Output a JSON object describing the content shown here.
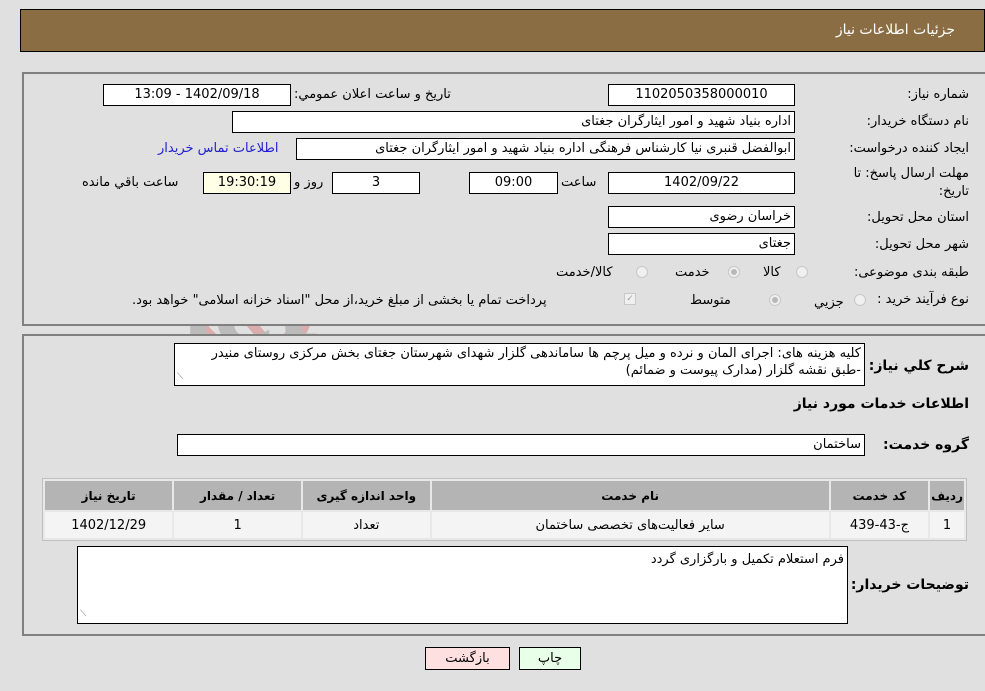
{
  "header": {
    "title": "جزئیات اطلاعات نیاز"
  },
  "details": {
    "need_number": {
      "label": "شماره نیاز:",
      "value": "1102050358000010"
    },
    "announce_datetime": {
      "label": "تاریخ و ساعت اعلان عمومي:",
      "value": "1402/09/18 - 13:09"
    },
    "buyer_org": {
      "label": "نام دستگاه خريدار:",
      "value": "اداره بنیاد شهید و امور ایثارگران جغتای"
    },
    "requester": {
      "label": "ايجاد کننده درخواست:",
      "value": "ابوالفضل قنبری نیا کارشناس فرهنگی اداره بنیاد شهید و امور ایثارگران جغتای",
      "contact_link": "اطلاعات تماس خريدار"
    },
    "deadline": {
      "label_line1": "مهلت ارسال پاسخ: تا",
      "label_line2": "تاریخ:",
      "date": "1402/09/22",
      "time_label": "ساعت",
      "time": "09:00",
      "days": "3",
      "days_label": "روز و",
      "remaining": "19:30:19",
      "remaining_label": "ساعت باقي مانده"
    },
    "province": {
      "label": "استان محل تحويل:",
      "value": "خراسان رضوی"
    },
    "city": {
      "label": "شهر محل تحويل:",
      "value": "جغتای"
    },
    "category": {
      "label": "طبقه بندی موضوعی:",
      "options": [
        {
          "label": "کالا",
          "checked": false
        },
        {
          "label": "خدمت",
          "checked": true
        },
        {
          "label": "کالا/خدمت",
          "checked": false
        }
      ]
    },
    "purchase_type": {
      "label": "نوع فرآیند خرید :",
      "options": [
        {
          "label": "جزيي",
          "checked": false
        },
        {
          "label": "متوسط",
          "checked": true
        }
      ],
      "payment_note": "پرداخت تمام یا بخشی از مبلغ خرید،از محل \"اسناد خزانه اسلامی\" خواهد بود.",
      "payment_checked": true
    }
  },
  "description": {
    "label": "شرح کلي نياز:",
    "value": "کلیه هزینه های: اجرای المان و نرده و میل پرچم ها ساماندهی گلزار شهدای شهرستان جغتای بخش مرکزی روستای منیدر -طبق نقشه گلزار (مدارک پیوست و ضمائم)"
  },
  "services": {
    "section_title": "اطلاعات خدمات مورد نياز",
    "group_label": "گروه خدمت:",
    "group_value": "ساختمان",
    "table": {
      "headers": [
        "رديف",
        "کد خدمت",
        "نام خدمت",
        "واحد اندازه گیری",
        "تعداد / مقدار",
        "تاریخ نیاز"
      ],
      "rows": [
        [
          "1",
          "ج-43-439",
          "سایر فعالیت‌های تخصصی ساختمان",
          "تعداد",
          "1",
          "1402/12/29"
        ]
      ]
    }
  },
  "buyer_notes": {
    "label": "توضيحات خريدار:",
    "value": "فرم استعلام تکمیل و بارگزاری گردد"
  },
  "buttons": {
    "print": "چاپ",
    "back": "بازگشت"
  },
  "watermark": {
    "text": "AriaTender.net"
  },
  "colors": {
    "header_bg": "#8b6d43",
    "link": "#2020d0",
    "print_bg": "#e8ffe8",
    "back_bg": "#ffe0e0"
  }
}
